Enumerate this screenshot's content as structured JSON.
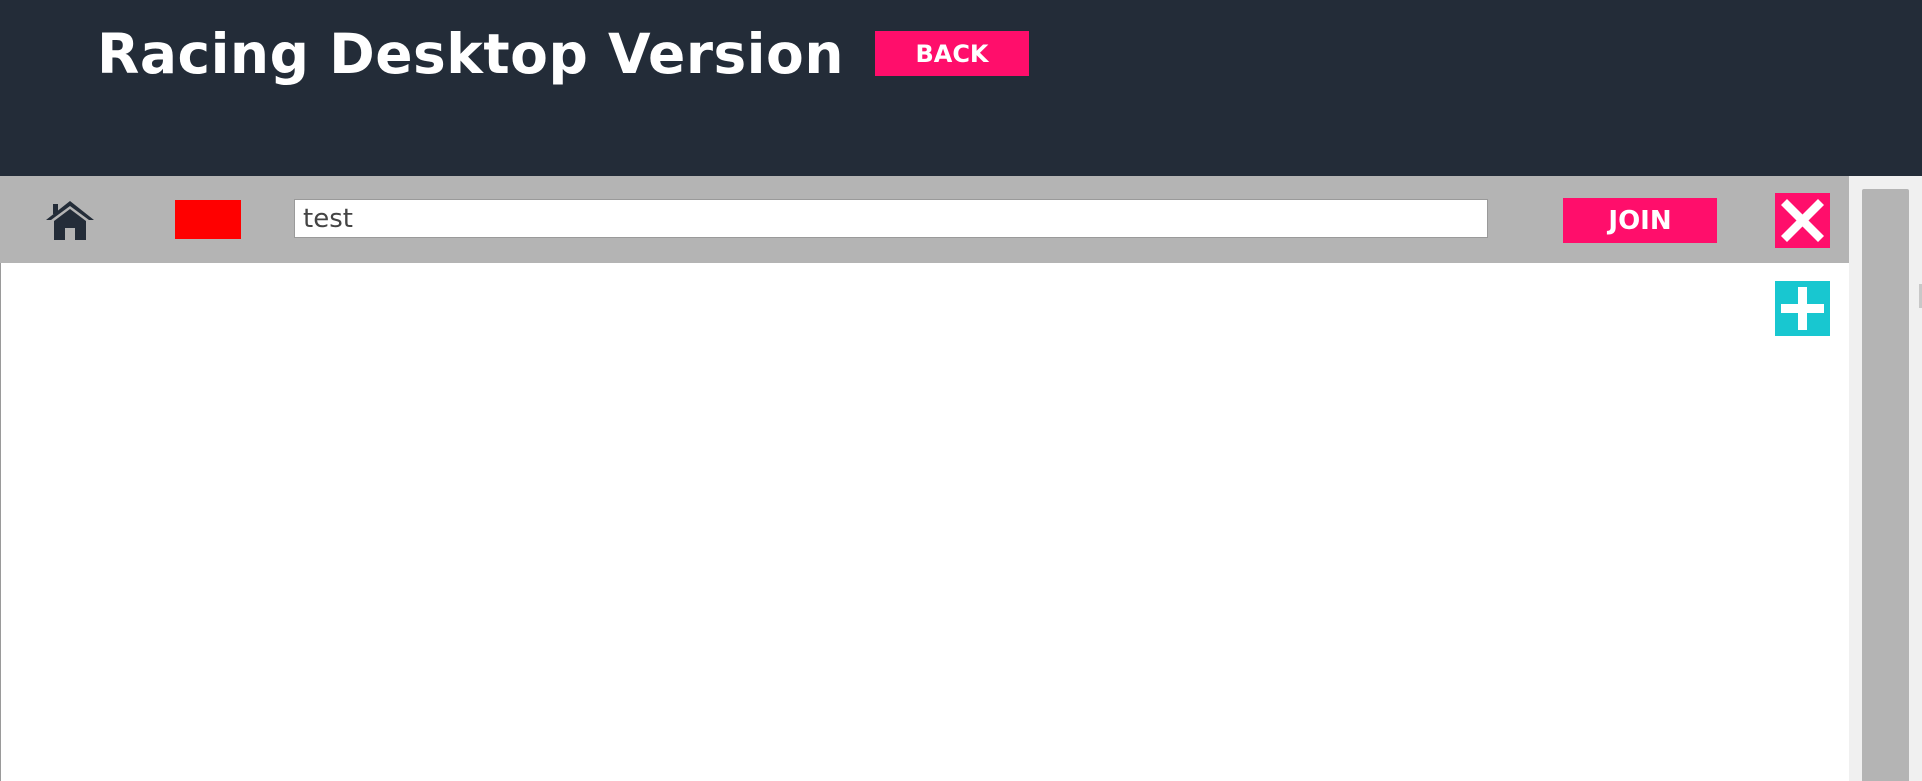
{
  "header": {
    "title": "Racing Desktop Version",
    "back_label": "BACK",
    "background_color": "#232c38"
  },
  "toolbar": {
    "home_icon": "home-icon",
    "color_swatch": "#ff0000",
    "name_input": {
      "value": "test",
      "placeholder": ""
    },
    "join_label": "JOIN",
    "close_icon": "close-icon",
    "add_icon": "plus-icon"
  },
  "colors": {
    "accent": "#ff0e6b",
    "add_button": "#18c7d0",
    "toolbar_background": "#b4b4b4"
  }
}
